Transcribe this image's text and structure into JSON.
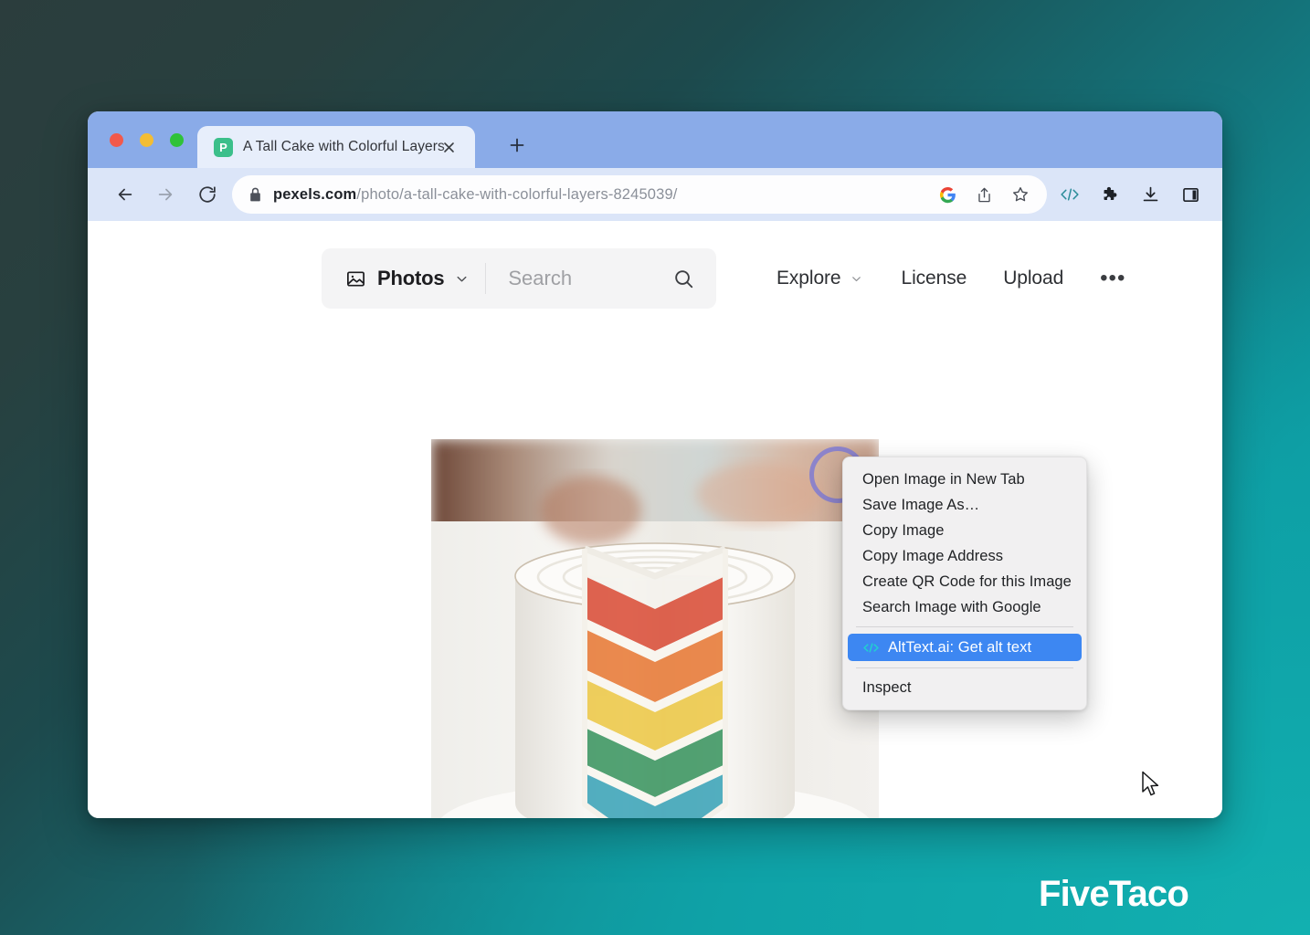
{
  "browser": {
    "window_controls": [
      "close",
      "minimize",
      "maximize"
    ],
    "tab": {
      "title": "A Tall Cake with Colorful Layers",
      "favicon_letter": "P",
      "favicon_name": "pexels-favicon",
      "close_label": "✕"
    },
    "new_tab_label": "+",
    "nav": {
      "back_label": "←",
      "forward_label": "→",
      "reload_label": "⟳"
    },
    "address": {
      "lock_icon": "lock-icon",
      "host": "pexels.com",
      "path": "/photo/a-tall-cake-with-colorful-layers-8245039/",
      "full_url": "pexels.com/photo/a-tall-cake-with-colorful-layers-8245039/"
    },
    "omnibox_icons": [
      "google-g-icon",
      "share-icon",
      "bookmark-star-icon"
    ],
    "extension_icons": [
      "alttext-ai-code-icon",
      "extensions-puzzle-icon",
      "downloads-icon",
      "side-panel-icon"
    ]
  },
  "pexels": {
    "category_button": {
      "label": "Photos",
      "icon": "image-icon",
      "chevron": "chevron-down-icon"
    },
    "search": {
      "placeholder": "Search",
      "value": "",
      "icon": "search-icon"
    },
    "links": [
      {
        "label": "Explore",
        "has_chevron": true
      },
      {
        "label": "License",
        "has_chevron": false
      },
      {
        "label": "Upload",
        "has_chevron": false
      }
    ],
    "overflow_label": "•••"
  },
  "photo": {
    "alt": "A tall white frosted layer cake with a slice removed revealing rainbow colored layers",
    "layer_colors": [
      "#d9432c",
      "#e8722a",
      "#e9b733",
      "#f0d24a",
      "#2f8f57",
      "#2aa39a",
      "#3f9fc9",
      "#8b3f6d"
    ]
  },
  "context_menu": {
    "items": [
      {
        "label": "Open Image in New Tab",
        "highlighted": false,
        "icon": null
      },
      {
        "label": "Save Image As…",
        "highlighted": false,
        "icon": null
      },
      {
        "label": "Copy Image",
        "highlighted": false,
        "icon": null
      },
      {
        "label": "Copy Image Address",
        "highlighted": false,
        "icon": null
      },
      {
        "label": "Create QR Code for this Image",
        "highlighted": false,
        "icon": null
      },
      {
        "label": "Search Image with Google",
        "highlighted": false,
        "icon": null
      },
      {
        "label": "AltText.ai: Get alt text",
        "highlighted": true,
        "icon": "code-icon"
      },
      {
        "label": "Inspect",
        "highlighted": false,
        "icon": null
      }
    ],
    "highlight_color": "#3d87f2",
    "background_color": "#f1f0f1"
  },
  "annotations": {
    "click_ring_color": "#7a78d6"
  },
  "brand": {
    "name": "FiveTaco"
  }
}
